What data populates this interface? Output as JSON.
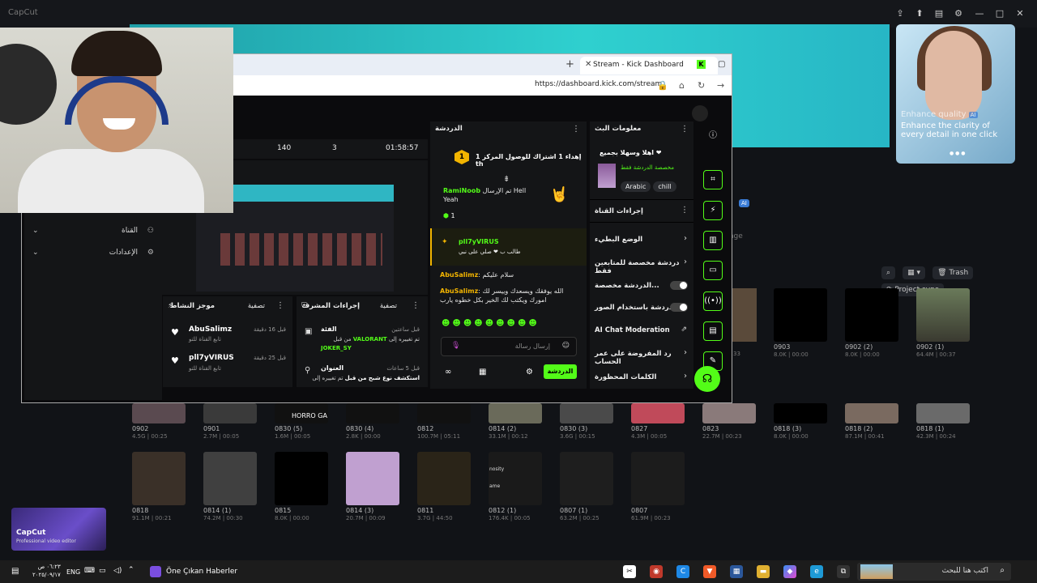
{
  "capcut": {
    "app_name": "CapCut",
    "ai_card": {
      "title": "Enhance quality",
      "badge": "AI",
      "subtitle": "Enhance the clarity of every detail in one click"
    },
    "ai_badge": "AI",
    "stage_label": "age",
    "toolbar": {
      "trash": "Trash",
      "project_sync": "Project sync"
    },
    "promo": {
      "title": "CapCut",
      "subtitle": "Professional video editor"
    },
    "overlay_labels": {
      "horror": "HORRO GA",
      "tile_33": "33",
      "nosity": "nosity",
      "ame": "ame"
    },
    "tiles_row1": [
      {
        "name": "0903",
        "meta": "8.0K | 00:00"
      },
      {
        "name": "0902 (2)",
        "meta": "8.0K | 00:00"
      },
      {
        "name": "0902 (1)",
        "meta": "64.4M | 00:37"
      }
    ],
    "tiles_row2": [
      {
        "name": "0902",
        "meta": "4.5G | 00:25"
      },
      {
        "name": "0901",
        "meta": "2.7M | 00:05"
      },
      {
        "name": "0830 (5)",
        "meta": "1.6M | 00:05"
      },
      {
        "name": "0830 (4)",
        "meta": "2.8K | 00:00"
      },
      {
        "name": "0812",
        "meta": "100.7M | 05:11"
      },
      {
        "name": "0814 (2)",
        "meta": "33.1M | 00:12"
      },
      {
        "name": "0830 (3)",
        "meta": "3.6G | 00:15"
      },
      {
        "name": "0827",
        "meta": "4.3M | 00:05"
      },
      {
        "name": "0823",
        "meta": "22.7M | 00:23"
      },
      {
        "name": "0818 (3)",
        "meta": "8.0K | 00:00"
      },
      {
        "name": "0818 (2)",
        "meta": "87.1M | 00:41"
      },
      {
        "name": "0818 (1)",
        "meta": "42.3M | 00:24"
      }
    ],
    "tiles_row3": [
      {
        "name": "0818",
        "meta": "91.1M | 00:21"
      },
      {
        "name": "0814 (1)",
        "meta": "74.2M | 00:30"
      },
      {
        "name": "0815",
        "meta": "8.0K | 00:00"
      },
      {
        "name": "0814 (3)",
        "meta": "20.7M | 00:09"
      },
      {
        "name": "0811",
        "meta": "3.7G | 44:50"
      },
      {
        "name": "0812 (1)",
        "meta": "176.4K | 00:05"
      },
      {
        "name": "0807 (1)",
        "meta": "63.2M | 00:25"
      },
      {
        "name": "0807",
        "meta": "61.9M | 00:23"
      }
    ]
  },
  "browser": {
    "tab_title": "Stream - Kick Dashboard",
    "url": "https://dashboard.kick.com/stream",
    "favicon": "K"
  },
  "dashboard": {
    "stats": {
      "a": "140",
      "b": "3",
      "time": "01:58:57"
    },
    "sidebar": [
      {
        "label": "القناة"
      },
      {
        "label": "الإعدادات"
      }
    ],
    "activity": {
      "title": "موجز النشاط",
      "filter": "تصفية",
      "items": [
        {
          "user": "AbuSalimz",
          "action": "تابع القناة للتو",
          "time": "قبل 16 دقيقة"
        },
        {
          "user": "pll7yVIRUS",
          "action": "تابع القناة للتو",
          "time": "قبل 25 دقيقة"
        }
      ]
    },
    "mod_actions": {
      "title": "إجراءات المشرف",
      "filter": "تصفية",
      "items": [
        {
          "label": "الفئة",
          "time": "قبل ساعتين",
          "change_prefix": "تم تغييره إلى",
          "value": "VALORANT",
          "from": "من قبل",
          "by": "JOKER_SY"
        },
        {
          "label": "العنوان",
          "time": "قبل 5 ساعات",
          "change_prefix": "تم تغييره إلى",
          "value": "استكشف نوع شبح من قبل"
        }
      ]
    },
    "chat": {
      "header": "الدردشة",
      "pinned_count": "1",
      "pinned": "إهداء 1 اشتراك للوصول المركز 1 th",
      "messages": [
        {
          "user": "RamiNoob",
          "text": "تم الإرسال Hell Yeah",
          "count": "1"
        },
        {
          "user": "pll7yVIRUS",
          "text": "طالب ب ❤ صلي على نبي"
        },
        {
          "user": "AbuSalimz",
          "text": "سلام عليكم"
        },
        {
          "user": "AbuSalimz",
          "text": "الله يوفقك ويسعدك وييسر لك امورك ويكتب لك الخير بكل خطوه يارب"
        }
      ],
      "input_placeholder": "إرسال رسالة",
      "send_label": "الدردشة"
    },
    "stream_info": {
      "title": "معلومات البث",
      "welcome": "اهلا وسهلا بجميع ❤",
      "subtitle": "مخصصة الدردشة فقط",
      "tags": [
        "Arabic",
        "chill"
      ]
    },
    "channel_actions": {
      "title": "إجراءات القناة",
      "items": [
        {
          "label": "الوضع البطيء"
        },
        {
          "label": "دردشة مخصصة للمتابعين فقط"
        },
        {
          "label": "الدردشة مخصصة..."
        },
        {
          "label": "الدردشة باستخدام الصور..."
        },
        {
          "label": "AI Chat Moderation"
        },
        {
          "label": "رد المفروضة على عمر الحساب"
        },
        {
          "label": "الكلمات المحظورة"
        }
      ]
    }
  },
  "taskbar": {
    "lang": "ENG",
    "time": "٠٦:٢٣ ص",
    "date": "٢٠٢٥/٠٩/١٧",
    "news": "Öne Çıkan Haberler",
    "search_placeholder": "اكتب هنا للبحث"
  }
}
